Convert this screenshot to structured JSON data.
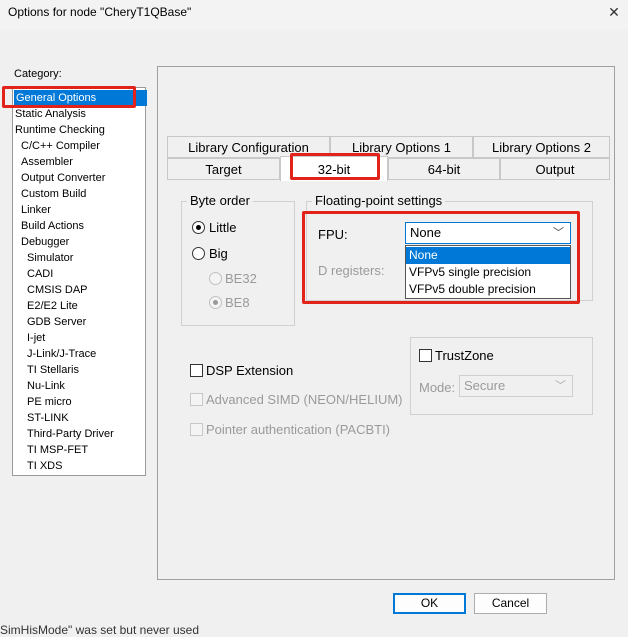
{
  "window": {
    "title": "Options for node \"CheryT1QBase\""
  },
  "category": {
    "label": "Category:",
    "items": [
      {
        "label": "General Options",
        "selected": true
      },
      {
        "label": "Static Analysis"
      },
      {
        "label": "Runtime Checking"
      },
      {
        "label": "C/C++ Compiler"
      },
      {
        "label": "Assembler"
      },
      {
        "label": "Output Converter"
      },
      {
        "label": "Custom Build"
      },
      {
        "label": "Linker"
      },
      {
        "label": "Build Actions"
      },
      {
        "label": "Debugger"
      },
      {
        "label": "Simulator"
      },
      {
        "label": "CADI"
      },
      {
        "label": "CMSIS DAP"
      },
      {
        "label": "E2/E2 Lite"
      },
      {
        "label": "GDB Server"
      },
      {
        "label": "I-jet"
      },
      {
        "label": "J-Link/J-Trace"
      },
      {
        "label": "TI Stellaris"
      },
      {
        "label": "Nu-Link"
      },
      {
        "label": "PE micro"
      },
      {
        "label": "ST-LINK"
      },
      {
        "label": "Third-Party Driver"
      },
      {
        "label": "TI MSP-FET"
      },
      {
        "label": "TI XDS"
      }
    ]
  },
  "tabs": {
    "row1": [
      "Library Configuration",
      "Library Options 1",
      "Library Options 2"
    ],
    "row2": [
      "Target",
      "32-bit",
      "64-bit",
      "Output"
    ],
    "active": "32-bit"
  },
  "byte_order": {
    "label": "Byte order",
    "little": "Little",
    "big": "Big",
    "be32": "BE32",
    "be8": "BE8"
  },
  "fp": {
    "label": "Floating-point settings",
    "fpu_label": "FPU:",
    "fpu_value": "None",
    "dreg_label": "D registers:",
    "options": [
      "None",
      "VFPv5 single precision",
      "VFPv5 double precision"
    ]
  },
  "dsp": {
    "label": "DSP Extension"
  },
  "simd": {
    "label": "Advanced SIMD (NEON/HELIUM)"
  },
  "pac": {
    "label": "Pointer authentication (PACBTI)"
  },
  "trustzone": {
    "label": "TrustZone",
    "mode_label": "Mode:",
    "mode_value": "Secure"
  },
  "buttons": {
    "ok": "OK",
    "cancel": "Cancel"
  },
  "status_text": "SimHisMode\" was set but never used"
}
